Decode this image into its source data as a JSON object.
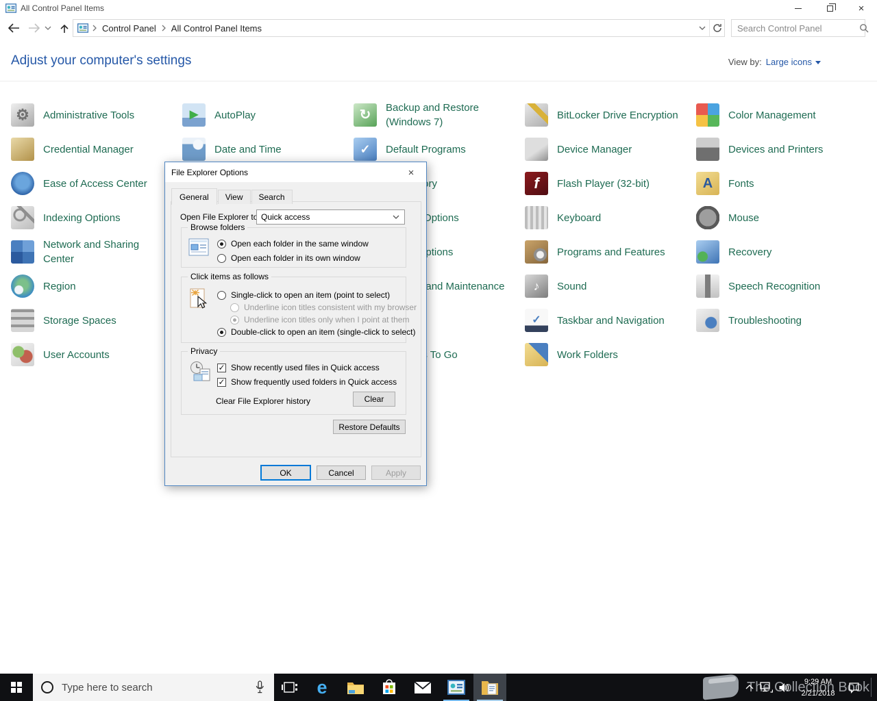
{
  "titlebar": {
    "title": "All Control Panel Items"
  },
  "toolbar": {
    "breadcrumb": [
      "Control Panel",
      "All Control Panel Items"
    ],
    "search_placeholder": "Search Control Panel"
  },
  "page": {
    "heading": "Adjust your computer's settings",
    "view_by_label": "View by:",
    "view_by_value": "Large icons"
  },
  "items": [
    {
      "label": "Administrative Tools",
      "icon": "administrative-tools-icon",
      "glyph": "⚙",
      "col": 0,
      "row": 0
    },
    {
      "label": "Credential Manager",
      "icon": "credential-manager-icon",
      "col": 0,
      "row": 1
    },
    {
      "label": "Ease of Access Center",
      "icon": "ease-of-access-center-icon",
      "col": 0,
      "row": 2
    },
    {
      "label": "Indexing Options",
      "icon": "indexing-options-icon",
      "col": 0,
      "row": 3
    },
    {
      "label": "Network and Sharing Center",
      "icon": "network-and-sharing-center-icon",
      "col": 0,
      "row": 4,
      "wrap": true
    },
    {
      "label": "Region",
      "icon": "region-icon",
      "col": 0,
      "row": 5
    },
    {
      "label": "Storage Spaces",
      "icon": "storage-spaces-icon",
      "col": 0,
      "row": 6
    },
    {
      "label": "User Accounts",
      "icon": "user-accounts-icon",
      "col": 0,
      "row": 7
    },
    {
      "label": "AutoPlay",
      "icon": "autoplay-icon",
      "glyph": "▶",
      "col": 1,
      "row": 0
    },
    {
      "label": "Date and Time",
      "icon": "date-and-time-icon",
      "col": 1,
      "row": 1
    },
    {
      "label": "Backup and Restore (Windows 7)",
      "icon": "backup-and-restore-icon",
      "glyph": "↻",
      "col": 2,
      "row": 0,
      "wrap": true
    },
    {
      "label": "Default Programs",
      "icon": "default-programs-icon",
      "glyph": "✓",
      "col": 2,
      "row": 1
    },
    {
      "label": "File History",
      "icon": "file-history-icon",
      "col": 2,
      "row": 2
    },
    {
      "label": "Internet Options",
      "icon": "internet-options-icon",
      "col": 2,
      "row": 3
    },
    {
      "label": "Power Options",
      "icon": "power-options-icon",
      "col": 2,
      "row": 4
    },
    {
      "label": "Security and Maintenance",
      "icon": "security-and-maintenance-icon",
      "col": 2,
      "row": 5
    },
    {
      "label": "Windows To Go",
      "icon": "windows-to-go-icon",
      "col": 2,
      "row": 7
    },
    {
      "label": "BitLocker Drive Encryption",
      "icon": "bitlocker-drive-encryption-icon",
      "col": 3,
      "row": 0
    },
    {
      "label": "Device Manager",
      "icon": "device-manager-icon",
      "col": 3,
      "row": 1
    },
    {
      "label": "Flash Player (32-bit)",
      "icon": "flash-player-icon",
      "glyph": "f",
      "col": 3,
      "row": 2
    },
    {
      "label": "Keyboard",
      "icon": "keyboard-icon",
      "col": 3,
      "row": 3
    },
    {
      "label": "Programs and Features",
      "icon": "programs-and-features-icon",
      "col": 3,
      "row": 4
    },
    {
      "label": "Sound",
      "icon": "sound-icon",
      "glyph": "♪",
      "col": 3,
      "row": 5
    },
    {
      "label": "Taskbar and Navigation",
      "icon": "taskbar-and-navigation-icon",
      "glyph": "✓",
      "col": 3,
      "row": 6
    },
    {
      "label": "Work Folders",
      "icon": "work-folders-icon",
      "col": 3,
      "row": 7
    },
    {
      "label": "Color Management",
      "icon": "color-management-icon",
      "col": 4,
      "row": 0
    },
    {
      "label": "Devices and Printers",
      "icon": "devices-and-printers-icon",
      "col": 4,
      "row": 1
    },
    {
      "label": "Fonts",
      "icon": "fonts-icon",
      "glyph": "A",
      "col": 4,
      "row": 2
    },
    {
      "label": "Mouse",
      "icon": "mouse-icon",
      "col": 4,
      "row": 3
    },
    {
      "label": "Recovery",
      "icon": "recovery-icon",
      "col": 4,
      "row": 4
    },
    {
      "label": "Speech Recognition",
      "icon": "speech-recognition-icon",
      "col": 4,
      "row": 5
    },
    {
      "label": "Troubleshooting",
      "icon": "troubleshooting-icon",
      "col": 4,
      "row": 6
    }
  ],
  "dialog": {
    "title": "File Explorer Options",
    "tabs": [
      {
        "label": "General",
        "active": true
      },
      {
        "label": "View",
        "active": false
      },
      {
        "label": "Search",
        "active": false
      }
    ],
    "open_to": {
      "label": "Open File Explorer to:",
      "value": "Quick access"
    },
    "browse_folders": {
      "title": "Browse folders",
      "options": [
        {
          "label": "Open each folder in the same window",
          "selected": true
        },
        {
          "label": "Open each folder in its own window",
          "selected": false
        }
      ]
    },
    "click_items": {
      "title": "Click items as follows",
      "options": [
        {
          "label": "Single-click to open an item (point to select)",
          "selected": false
        },
        {
          "label": "Underline icon titles consistent with my browser",
          "selected": false,
          "disabled": true,
          "indent": true
        },
        {
          "label": "Underline icon titles only when I point at them",
          "selected": true,
          "disabled": true,
          "indent": true
        },
        {
          "label": "Double-click to open an item (single-click to select)",
          "selected": true
        }
      ]
    },
    "privacy": {
      "title": "Privacy",
      "options": [
        {
          "label": "Show recently used files in Quick access",
          "checked": true
        },
        {
          "label": "Show frequently used folders in Quick access",
          "checked": true
        }
      ],
      "clear_label": "Clear File Explorer history",
      "clear_button": "Clear"
    },
    "buttons": {
      "restore": "Restore Defaults",
      "ok": "OK",
      "cancel": "Cancel",
      "apply": "Apply",
      "apply_disabled": true
    }
  },
  "taskbar": {
    "search_placeholder": "Type here to search",
    "apps": [
      {
        "name": "edge",
        "open": false,
        "active": false
      },
      {
        "name": "file-explorer",
        "open": false,
        "active": false
      },
      {
        "name": "store",
        "open": false,
        "active": false
      },
      {
        "name": "mail",
        "open": false,
        "active": false
      },
      {
        "name": "control-panel",
        "open": true,
        "active": false
      },
      {
        "name": "file-explorer-options",
        "open": true,
        "active": true
      }
    ],
    "clock": {
      "time": "9:29 AM",
      "date": "2/21/2018"
    }
  },
  "watermark": {
    "text": "The Collection Book"
  },
  "colors": {
    "accent": "#0078d7",
    "item_text": "#1e6b52",
    "heading": "#2457a7",
    "taskbar": "#0f1013",
    "open_indicator": "#76b9ed",
    "dialog_bg": "#f0f0f0"
  }
}
